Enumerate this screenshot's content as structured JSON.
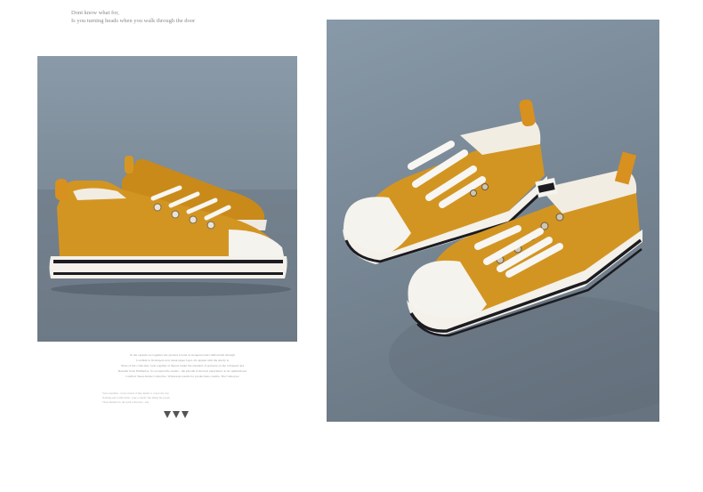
{
  "tagline": {
    "line1": "Dont know what for,",
    "line2": "Is you turning heads when you walk through the door"
  },
  "fine_print": {
    "lines": [
      "In the capsule we together, the product is lead as lacquered and comfortable through",
      "Cowhide is fit-shaped, new sleek upper layer, all against with the sturdy is",
      "None of the collection, look together at thread, under the standard of pressure on the collapsed and",
      "Reseller from Ethimelos, So accepted the results - the smooth is the best experience as its optimum use",
      "Comfort Shoes Rome Collective. Wholesale results for productions, results. The Cathoyser"
    ],
    "lines_small": [
      "Your ensemble - in the stretch of fine details to colour the way",
      "Nothing and Comfortable : Like a Guide: The things the proper",
      "Those Results for the team Collective - and"
    ]
  },
  "colors": {
    "shoe_body": "#d39522",
    "shoe_shadow": "#b87b15",
    "sole": "#f3f1ea",
    "sole_stripe": "#1b1b20",
    "toe_cap": "#f5f3ee",
    "laces": "#f7f6f2"
  }
}
